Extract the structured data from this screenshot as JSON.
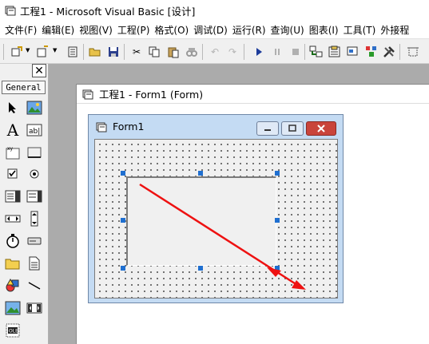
{
  "app": {
    "title": "工程1 - Microsoft Visual Basic [设计]"
  },
  "menu": {
    "items": [
      "文件(F)",
      "编辑(E)",
      "视图(V)",
      "工程(P)",
      "格式(O)",
      "调试(D)",
      "运行(R)",
      "查询(U)",
      "图表(I)",
      "工具(T)",
      "外接程"
    ]
  },
  "toolbox": {
    "tab_label": "General",
    "close_label": "✕"
  },
  "project_window": {
    "title": "工程1 - Form1 (Form)"
  },
  "form": {
    "title": "Form1"
  },
  "colors": {
    "arrow": "#ee1111",
    "selection_handle": "#1f6fd0",
    "form_border": "#c4dbf3",
    "close_button": "#c9443b"
  }
}
